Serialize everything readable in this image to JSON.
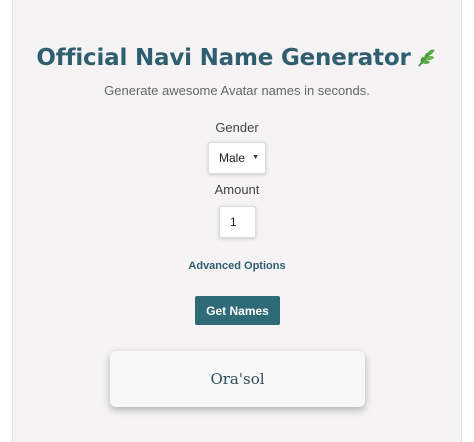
{
  "header": {
    "title": "Official Navi Name Generator",
    "title_icon": "leaf-icon",
    "subtitle": "Generate awesome Avatar names in seconds."
  },
  "form": {
    "gender_label": "Gender",
    "gender_value": "Male",
    "amount_label": "Amount",
    "amount_value": "1",
    "advanced_options_label": "Advanced Options",
    "submit_label": "Get Names"
  },
  "results": [
    {
      "name": "Ora'sol"
    }
  ],
  "colors": {
    "title": "#2f5f6f",
    "button": "#2f6a77",
    "panel_background": "#f5f3f4",
    "leaf": "#4a9a3c"
  }
}
